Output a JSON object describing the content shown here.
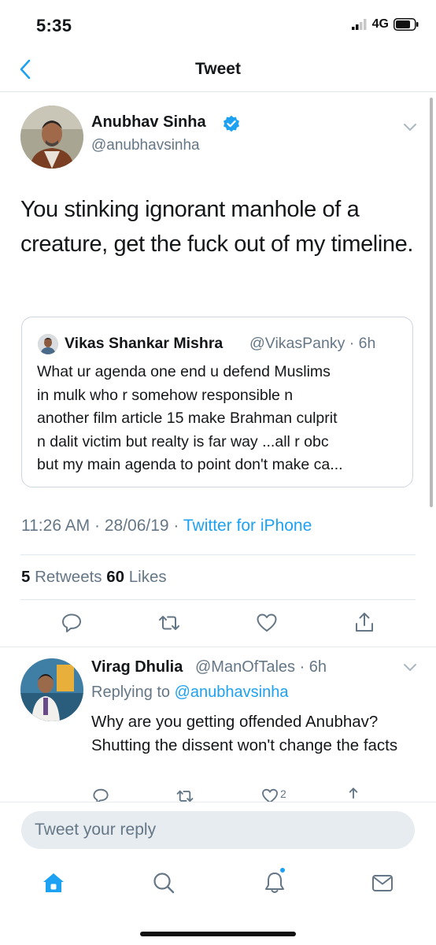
{
  "status_bar": {
    "time": "5:35",
    "network": "4G"
  },
  "nav": {
    "title": "Tweet"
  },
  "tweet": {
    "author_name": "Anubhav Sinha",
    "author_handle": "@anubhavsinha",
    "text": "You stinking ignorant manhole of a creature, get the fuck out of my timeline.",
    "quote": {
      "author_name": "Vikas Shankar Mishra",
      "author_handle_time": "@VikasPanky · 6h",
      "lines": [
        "What ur agenda one end u defend Muslims",
        "in mulk who r somehow responsible n",
        "another film article 15 make Brahman culprit",
        "n dalit victim but realty is far way ...all r obc",
        "but my main agenda to point don't make ca..."
      ]
    },
    "timestamp": "11:26 AM · 28/06/19 · ",
    "source": "Twitter for iPhone",
    "retweets_count": "5",
    "retweets_label": " Retweets ",
    "likes_count": "60",
    "likes_label": " Likes"
  },
  "reply": {
    "author_name": "Virag Dhulia",
    "author_handle_time": "@ManOfTales · 6h",
    "replying_prefix": "Replying to ",
    "replying_to": "@anubhavsinha",
    "text": "Why are you getting offended Anubhav? Shutting the dissent won't change the facts",
    "like_count": "2"
  },
  "composer": {
    "placeholder": "Tweet your reply"
  },
  "icons": {
    "back": "chevron-left-icon",
    "verified": "verified-badge-icon",
    "reply": "comment-icon",
    "retweet": "retweet-icon",
    "like": "heart-icon",
    "share": "share-icon",
    "tabs": [
      "home-icon",
      "search-icon",
      "notifications-icon",
      "messages-icon"
    ]
  },
  "colors": {
    "accent": "#1da1f2",
    "secondary_text": "#657786",
    "divider": "#e1e8ed"
  }
}
